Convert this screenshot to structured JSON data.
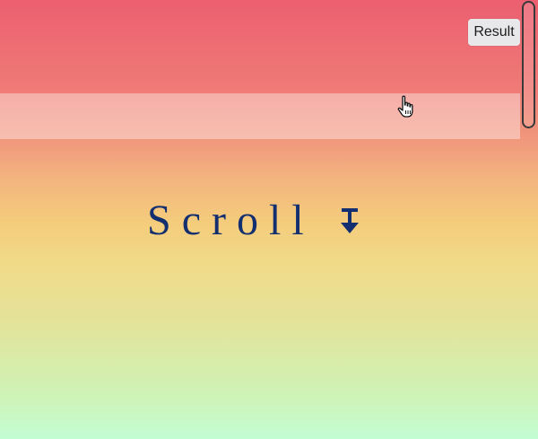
{
  "headline": {
    "text": "Scroll",
    "arrow_icon": "arrow-down-to-bar-icon"
  },
  "toolbar": {
    "result_label": "Result"
  },
  "colors": {
    "text": "#142f6f",
    "gradient_top": "#ec5f70",
    "gradient_middle": "#f4cd7c",
    "gradient_bottom": "#c3fdd3"
  },
  "cursor": {
    "icon": "hand-pointer-icon"
  }
}
